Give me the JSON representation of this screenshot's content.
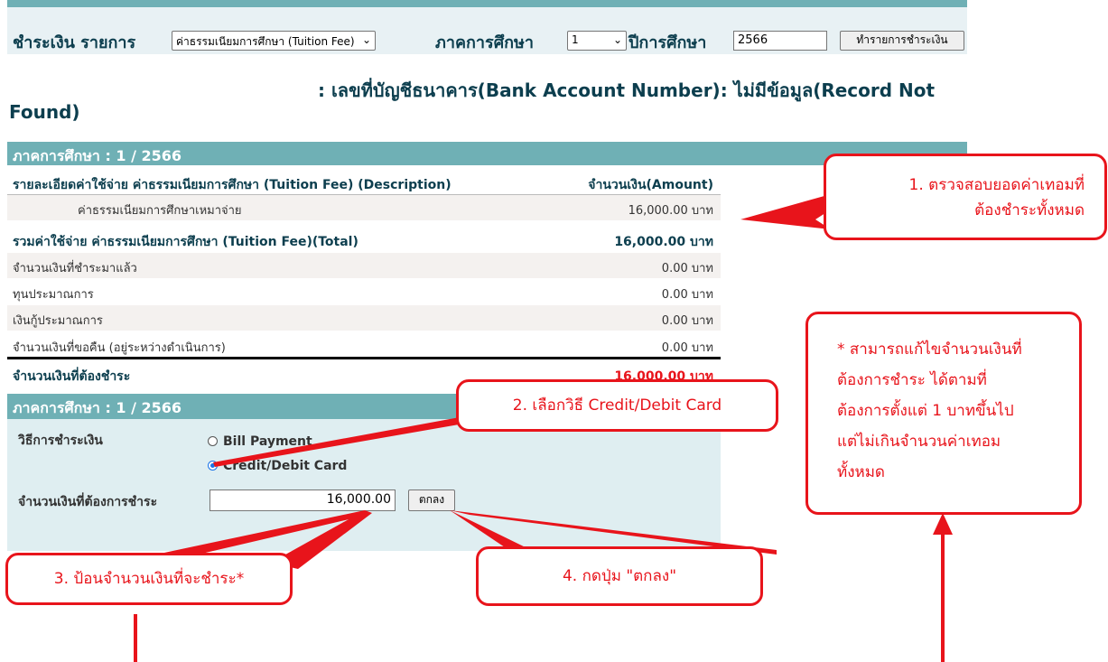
{
  "colors": {
    "teal": "#6fb0b5",
    "callout_red": "#e8141b",
    "text_navy": "#0c3e4e"
  },
  "filter": {
    "payment_label": "ชำระเงิน รายการ",
    "item_select": "ค่าธรรมเนียมการศึกษา (Tuition Fee)",
    "semester_label": "ภาคการศึกษา",
    "semester_select": "1",
    "year_label": "ปีการศึกษา",
    "year_value": "2566",
    "do_payment_button": "ทำรายการชำระเงิน"
  },
  "account": {
    "line1": ": เลขที่บัญชีธนาคาร(Bank Account Number): ไม่มีข้อมูล(Record Not",
    "line2": "Found)"
  },
  "semester_header": "ภาคการศึกษา : 1 / 2566",
  "table": {
    "header_desc": "รายละเอียดค่าใช้จ่าย ค่าธรรมเนียมการศึกษา (Tuition Fee) (Description)",
    "header_amount": "จำนวนเงิน(Amount)",
    "rows": [
      {
        "label": "ค่าธรรมเนียมการศึกษาเหมาจ่าย",
        "amount": "16,000.00  บาท"
      },
      {
        "label": "รวมค่าใช้จ่าย ค่าธรรมเนียมการศึกษา (Tuition Fee)(Total)",
        "amount": "16,000.00  บาท"
      },
      {
        "label": "จำนวนเงินที่ชำระมาแล้ว",
        "amount": "0.00  บาท"
      },
      {
        "label": "ทุนประมาณการ",
        "amount": "0.00  บาท"
      },
      {
        "label": "เงินกู้ประมาณการ",
        "amount": "0.00  บาท"
      },
      {
        "label": "จำนวนเงินที่ขอคืน (อยู่ระหว่างดำเนินการ)",
        "amount": "0.00  บาท"
      },
      {
        "label": "จำนวนเงินที่ต้องชำระ",
        "amount": "16,000.00  บาท"
      }
    ]
  },
  "payment": {
    "header": "ภาคการศึกษา : 1 / 2566",
    "method_label": "วิธีการชำระเงิน",
    "option_bill": "Bill Payment",
    "option_card": "Credit/Debit Card",
    "amount_label": "จำนวนเงินที่ต้องการชำระ",
    "amount_value": "16,000.00",
    "ok_button": "ตกลง"
  },
  "callouts": {
    "c1_line1": "1. ตรวจสอบยอดค่าเทอมที่",
    "c1_line2": "ต้องชำระทั้งหมด",
    "c2": "2. เลือกวิธี Credit/Debit Card",
    "c3": "3. ป้อนจำนวนเงินที่จะชำระ*",
    "c4": "4. กดปุ่ม \"ตกลง\"",
    "note_l1": "* สามารถแก้ไขจำนวนเงินที่",
    "note_l2": "ต้องการชำระ ได้ตามที่",
    "note_l3": "ต้องการตั้งแต่ 1 บาทขึ้นไป",
    "note_l4": "แต่ไม่เกินจำนวนค่าเทอม",
    "note_l5": "ทั้งหมด"
  }
}
